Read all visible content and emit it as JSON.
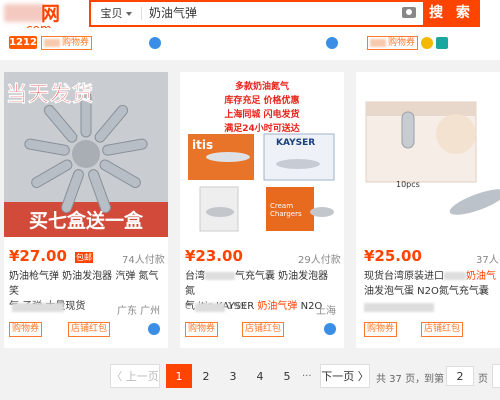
{
  "header": {
    "logo_text": "网",
    "logo_sub": "com",
    "search_scope": "宝贝",
    "search_query": "奶油气弹",
    "search_button": "搜 索"
  },
  "top_strip": {
    "tag": "1212",
    "coupon_1": "购物券",
    "coupon_2": "购物券"
  },
  "products": [
    {
      "banner_top": "当天发货",
      "banner_bottom": "买七盒送一盒",
      "price": "¥27.00",
      "price_tag": "包邮",
      "sales": "74人付款",
      "title_1": "奶油枪气弹 奶油发泡器 汽弹 氮气 笑",
      "title_2": "气 子弹 大量现货",
      "location": "广东 广州",
      "badge_1": "购物券",
      "badge_2": "店铺红包"
    },
    {
      "ad_line_1": "多款奶油氮气",
      "ad_line_2": "库存充足  价格优惠",
      "ad_line_3": "上海同城  闪电发货",
      "ad_line_4": "满足24小时可送达",
      "brand_1": "itis",
      "brand_2": "KAYSER",
      "box_label": "Cream Chargers",
      "price": "¥23.00",
      "sales": "29人付款",
      "title_1": "台湾",
      "title_1b": "气充气囊 奶油发泡器氮",
      "title_2a": "气 itis KAYSER ",
      "title_2b": "奶油气弹",
      "title_2c": " N2O",
      "shop_prefix": "e",
      "shop_suffix": "199",
      "location": "上海",
      "badge_1": "购物券",
      "badge_2": "店铺红包"
    },
    {
      "box_label": "10pcs",
      "price": "¥25.00",
      "sales": "37人",
      "title_1a": "现货台湾原装进口",
      "title_1b": "奶油气",
      "title_2": "油发泡气蛋 N2O氮气充气囊",
      "badge_1": "购物券",
      "badge_2": "店铺红包"
    }
  ],
  "pager": {
    "prev": "〈 上一页",
    "pages": [
      "1",
      "2",
      "3",
      "4",
      "5"
    ],
    "ellipsis": "...",
    "next": "下一页 〉",
    "total": "共 37 页，",
    "goto": "到第",
    "goto_value": "2",
    "page_unit": "页"
  },
  "colors": {
    "accent": "#ff4400",
    "badge_border": "#ff7a2f"
  }
}
